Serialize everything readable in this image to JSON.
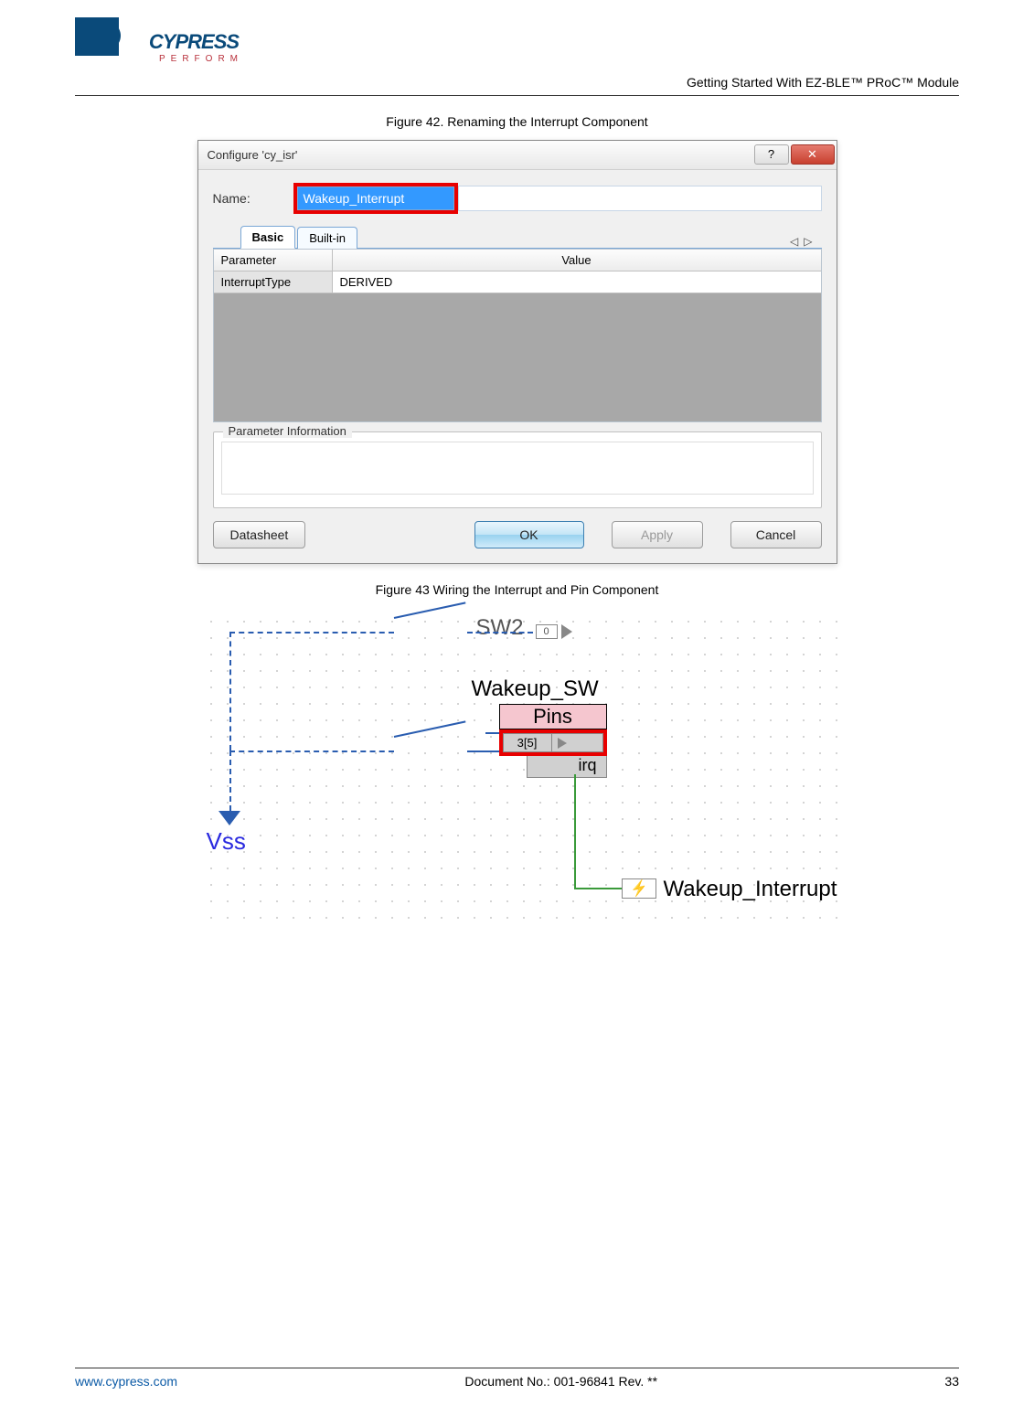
{
  "header": {
    "logo_main": "CYPRESS",
    "logo_sub": "PERFORM",
    "page_title": "Getting Started With EZ-BLE™ PRoC™ Module"
  },
  "figure42": {
    "caption": "Figure 42. Renaming the Interrupt Component",
    "dialog_title": "Configure 'cy_isr'",
    "name_label": "Name:",
    "name_value": "Wakeup_Interrupt",
    "tabs": {
      "basic": "Basic",
      "builtin": "Built-in"
    },
    "grid": {
      "header_parameter": "Parameter",
      "header_value": "Value",
      "rows": [
        {
          "parameter": "InterruptType",
          "value": "DERIVED"
        }
      ]
    },
    "param_info_label": "Parameter Information",
    "buttons": {
      "datasheet": "Datasheet",
      "ok": "OK",
      "apply": "Apply",
      "cancel": "Cancel"
    }
  },
  "figure43": {
    "caption": "Figure 43 Wiring the Interrupt and Pin Component",
    "sw2_label": "SW2",
    "sw2_pin": "0",
    "wakeup_sw_label": "Wakeup_SW",
    "pins_header": "Pins",
    "pin_port": "3[5]",
    "irq_label": "irq",
    "vss_label": "Vss",
    "interrupt_label": "Wakeup_Interrupt"
  },
  "footer": {
    "url": "www.cypress.com",
    "docno": "Document No.: 001-96841 Rev. **",
    "page": "33"
  }
}
